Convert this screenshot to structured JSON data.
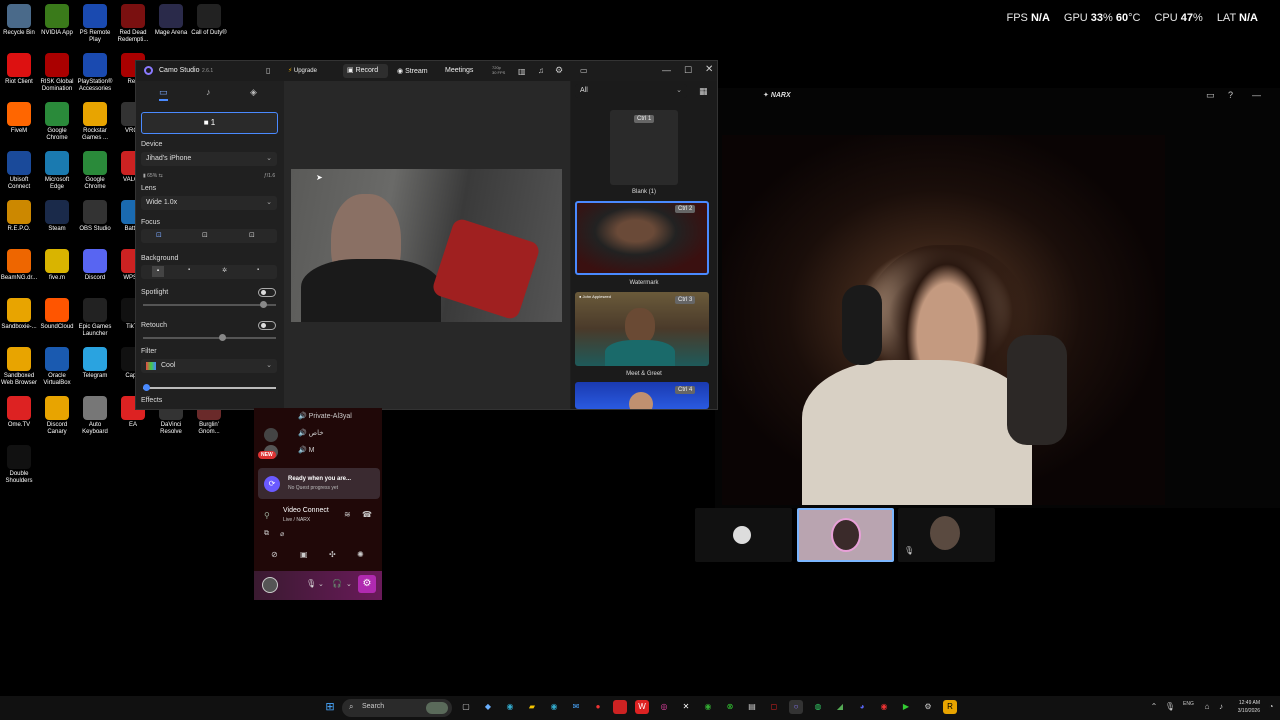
{
  "overlay": {
    "fps_label": "FPS",
    "fps_value": "N/A",
    "gpu_label": "GPU",
    "gpu_value": "33",
    "gpu_pct": "%",
    "gpu_temp": "60",
    "gpu_unit": "°C",
    "cpu_label": "CPU",
    "cpu_value": "47",
    "cpu_pct": "%",
    "lat_label": "LAT",
    "lat_value": "N/A"
  },
  "desktop_icons": [
    {
      "label": "Recycle Bin",
      "color": "#4a6a8a"
    },
    {
      "label": "NVIDIA App",
      "color": "#3a7a1a"
    },
    {
      "label": "PS Remote Play",
      "color": "#1a4ab0"
    },
    {
      "label": "Red Dead Redempti...",
      "color": "#7a1010"
    },
    {
      "label": "Mage Arena",
      "color": "#2a2a4a"
    },
    {
      "label": "Call of Duty®",
      "color": "#222"
    },
    {
      "label": "Riot Client",
      "color": "#d11"
    },
    {
      "label": "RISK Global Domination",
      "color": "#a00"
    },
    {
      "label": "PlayStation® Accessories",
      "color": "#1a4ab0"
    },
    {
      "label": "Red",
      "color": "#a00"
    },
    {
      "label": "FiveM",
      "color": "#f60"
    },
    {
      "label": "Google Chrome",
      "color": "#2a8a3a"
    },
    {
      "label": "Rockstar Games ...",
      "color": "#e8a400"
    },
    {
      "label": "VRCh",
      "color": "#333"
    },
    {
      "label": "Ubisoft Connect",
      "color": "#1a4a9a"
    },
    {
      "label": "Microsoft Edge",
      "color": "#1a7ab0"
    },
    {
      "label": "Google Chrome",
      "color": "#2a8a3a"
    },
    {
      "label": "VALOR",
      "color": "#c22"
    },
    {
      "label": "R.E.P.O.",
      "color": "#c80"
    },
    {
      "label": "Steam",
      "color": "#1a2a4a"
    },
    {
      "label": "OBS Studio",
      "color": "#333"
    },
    {
      "label": "Battle.",
      "color": "#1a6ab0"
    },
    {
      "label": "BeamNG.dr...",
      "color": "#e60"
    },
    {
      "label": "five.m",
      "color": "#d9b400"
    },
    {
      "label": "Discord",
      "color": "#5865f2"
    },
    {
      "label": "WPS P",
      "color": "#c22"
    },
    {
      "label": "Sandboxie-...",
      "color": "#e8a400"
    },
    {
      "label": "SoundCloud",
      "color": "#f50"
    },
    {
      "label": "Epic Games Launcher",
      "color": "#222"
    },
    {
      "label": "TikTo",
      "color": "#111"
    },
    {
      "label": "Sandboxed Web Browser",
      "color": "#e8a400"
    },
    {
      "label": "Oracle VirtualBox",
      "color": "#1a5ab0"
    },
    {
      "label": "Telegram",
      "color": "#2aa3e0"
    },
    {
      "label": "CapC",
      "color": "#111"
    },
    {
      "label": "Ome.TV",
      "color": "#d22"
    },
    {
      "label": "Discord Canary",
      "color": "#e8a400"
    },
    {
      "label": "Auto Keyboard",
      "color": "#777"
    },
    {
      "label": "EA",
      "color": "#d22"
    },
    {
      "label": "DaVinci Resolve",
      "color": "#333"
    },
    {
      "label": "Burglin' Gnom...",
      "color": "#6a2a2a"
    },
    {
      "label": "Double Shoulders",
      "color": "#111"
    }
  ],
  "camo": {
    "app_name": "Camo Studio",
    "version": "2.6.1",
    "upgrade": "Upgrade",
    "record": "Record",
    "stream": "Stream",
    "meetings": "Meetings",
    "res_line1": "720p",
    "res_line2": "30 FPS",
    "source_number": "1",
    "device_label": "Device",
    "device_value": "Jihad's iPhone",
    "battery": "65%",
    "aperture": "ƒ/1.6",
    "lens_label": "Lens",
    "lens_value": "Wide 1.0x",
    "focus_label": "Focus",
    "background_label": "Background",
    "spotlight_label": "Spotlight",
    "retouch_label": "Retouch",
    "filter_label": "Filter",
    "filter_value": "Cool",
    "effects_label": "Effects",
    "scenes_filter": "All",
    "scenes": [
      {
        "tag": "Ctrl",
        "key": "1",
        "name": "Blank (1)"
      },
      {
        "tag": "Ctrl",
        "key": "2",
        "name": "Watermark"
      },
      {
        "tag": "Ctrl",
        "key": "3",
        "name": "Meet & Greet",
        "overlay_name": "John Appleseed"
      },
      {
        "tag": "Ctrl",
        "key": "4",
        "name": ""
      }
    ]
  },
  "call": {
    "title": "NARX"
  },
  "discord": {
    "channel1": "Private-Al3yal",
    "channel2": "خاص",
    "channel3": "M",
    "new_badge": "NEW",
    "quest_title": "Ready when you are...",
    "quest_sub": "No Quest progress yet",
    "voice_title": "Video Connect",
    "voice_sub": "Live / NARX"
  },
  "taskbar": {
    "search": "Search",
    "time": "12:49 AM",
    "date": "3/10/2026",
    "lang": "ENG"
  }
}
